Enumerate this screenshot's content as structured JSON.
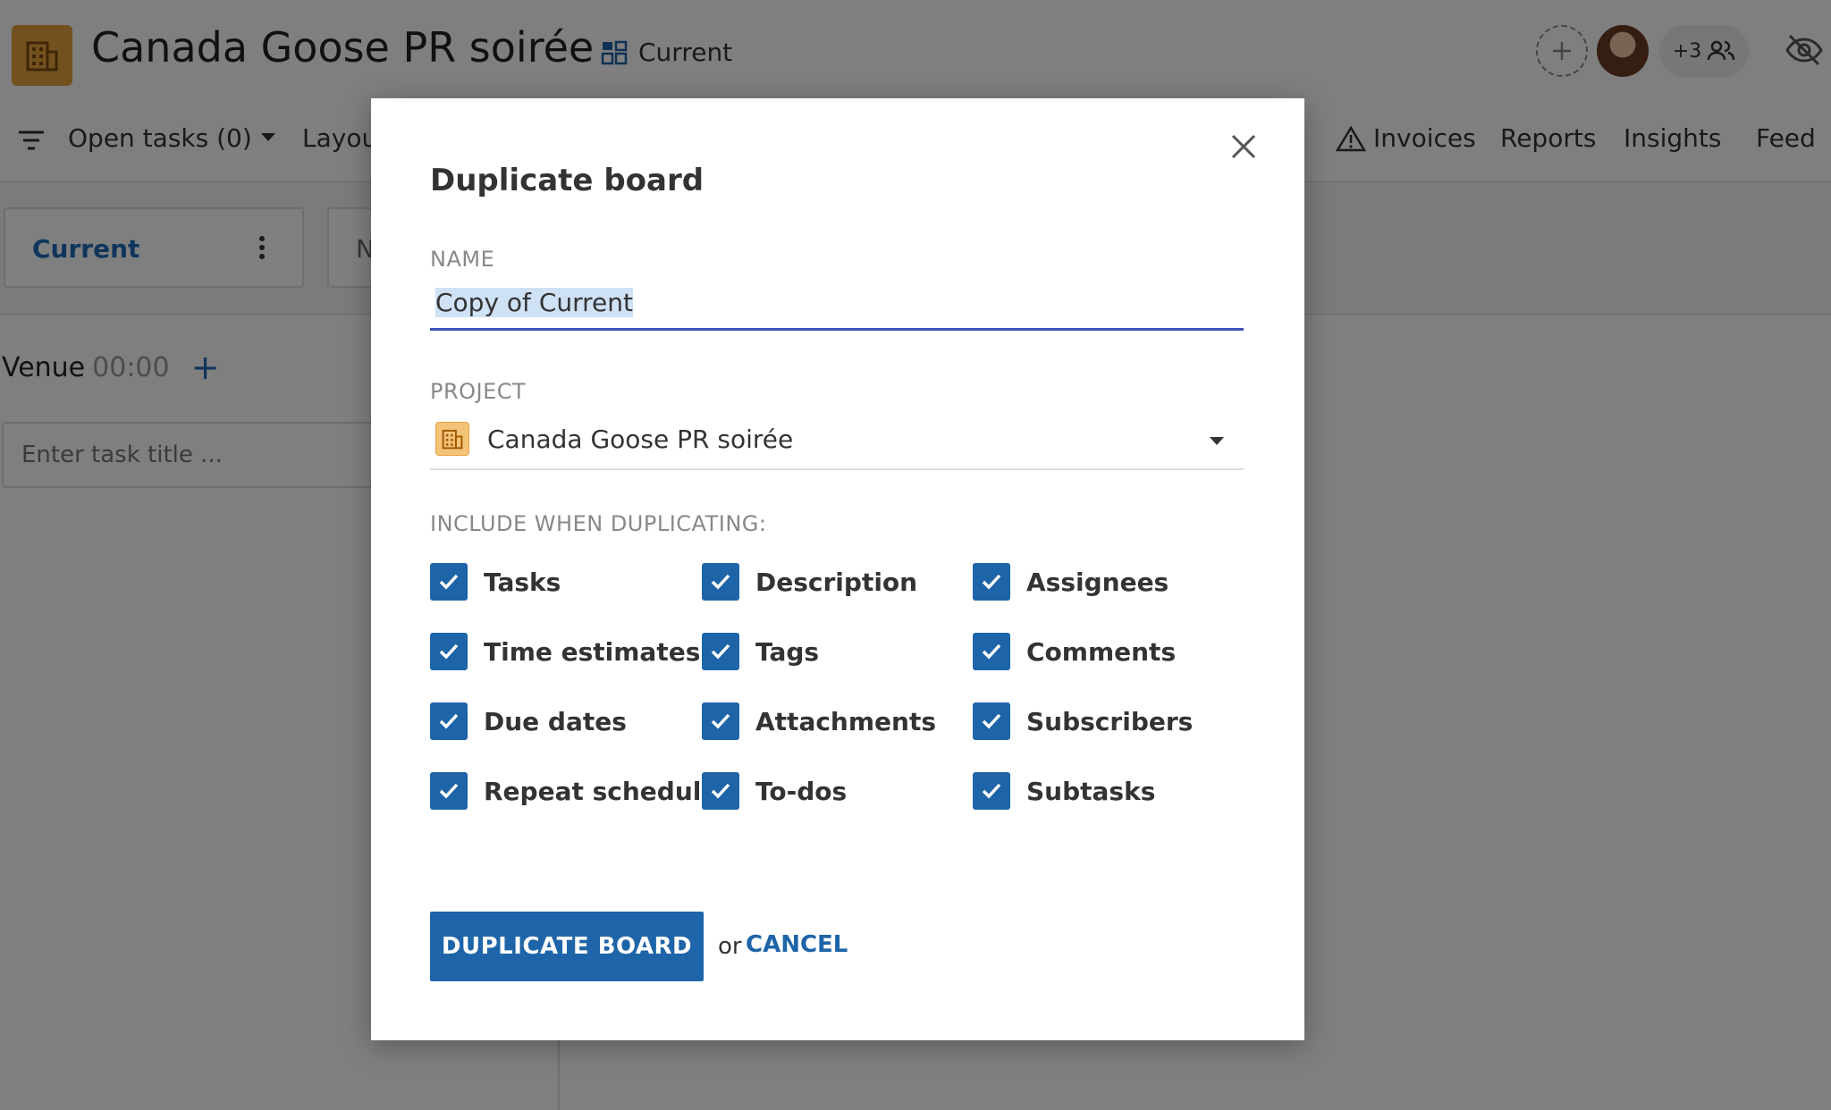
{
  "header": {
    "project_title": "Canada Goose PR soirée",
    "board_name": "Current",
    "extra_members": "+3"
  },
  "toolbar": {
    "open_tasks": "Open tasks (0)",
    "layout": "Layou",
    "nav": [
      "Invoices",
      "Reports",
      "Insights",
      "Feed"
    ]
  },
  "boards": {
    "tabs": [
      "Current",
      "N"
    ]
  },
  "column": {
    "title": "Venue",
    "time": "00:00",
    "add": "+",
    "task_placeholder": "Enter task title ..."
  },
  "modal": {
    "title": "Duplicate board",
    "name_label": "NAME",
    "name_value": "Copy of Current",
    "project_label": "PROJECT",
    "project_value": "Canada Goose PR soirée",
    "include_label": "INCLUDE WHEN DUPLICATING:",
    "options": [
      {
        "label": "Tasks",
        "checked": true
      },
      {
        "label": "Description",
        "checked": true
      },
      {
        "label": "Assignees",
        "checked": true
      },
      {
        "label": "Time estimates",
        "checked": true
      },
      {
        "label": "Tags",
        "checked": true
      },
      {
        "label": "Comments",
        "checked": true
      },
      {
        "label": "Due dates",
        "checked": true
      },
      {
        "label": "Attachments",
        "checked": true
      },
      {
        "label": "Subscribers",
        "checked": true
      },
      {
        "label": "Repeat schedule",
        "checked": true
      },
      {
        "label": "To-dos",
        "checked": true
      },
      {
        "label": "Subtasks",
        "checked": true
      }
    ],
    "primary_button": "DUPLICATE BOARD",
    "or_text": "or",
    "cancel": "CANCEL"
  },
  "colors": {
    "primary": "#1e64a8",
    "accent_underline": "#3f51b5",
    "project_icon": "#e6a23c",
    "overlay": "rgba(0,0,0,0.5)"
  }
}
